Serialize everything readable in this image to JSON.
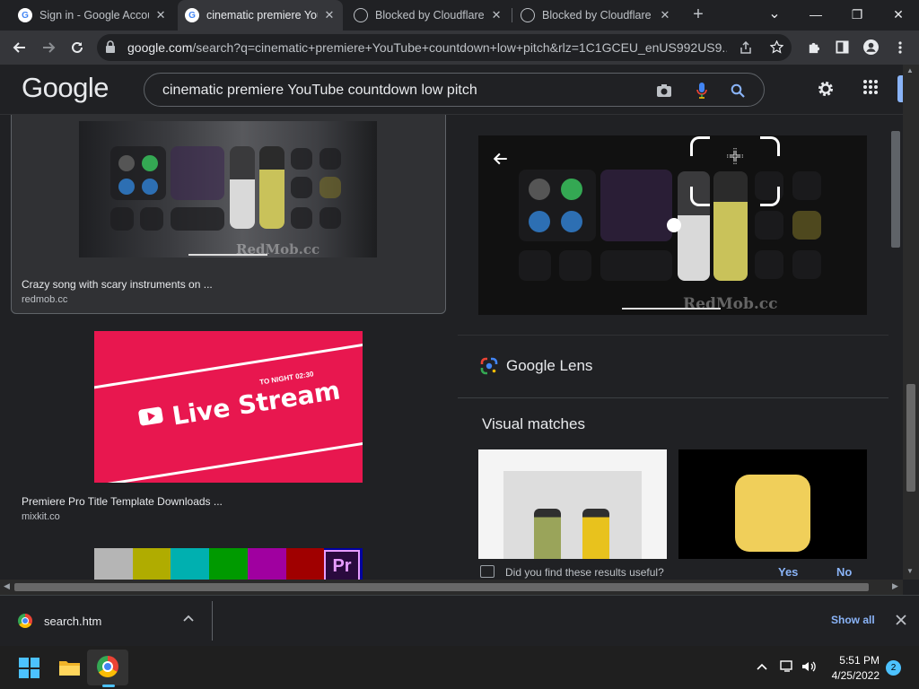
{
  "browser": {
    "tabs": [
      {
        "title": "Sign in - Google Accou",
        "favicon": "google-g-icon"
      },
      {
        "title": "cinematic premiere You",
        "favicon": "google-g-icon",
        "active": true
      },
      {
        "title": "Blocked by Cloudflare",
        "favicon": "globe-icon"
      },
      {
        "title": "Blocked by Cloudflare",
        "favicon": "globe-icon"
      }
    ],
    "close_glyph": "✕",
    "new_tab_glyph": "+",
    "tab_menu_glyph": "⌄",
    "window": {
      "minimize": "—",
      "restore": "❐",
      "close": "✕"
    },
    "url_host": "google.com",
    "url_rest": "/search?q=cinematic+premiere+YouTube+countdown+low+pitch&rlz=1C1GCEU_enUS992US9..."
  },
  "google": {
    "logo": "Google",
    "query": "cinematic premiere YouTube countdown low pitch"
  },
  "results": {
    "items": [
      {
        "caption": "Crazy song with scary instruments on ...",
        "source": "redmob.cc",
        "watermark": "RedMob.cc"
      },
      {
        "caption": "Premiere Pro Title Template Downloads ...",
        "source": "mixkit.co",
        "image_text": "Live Stream",
        "image_subtext": "TO NIGHT 02:30"
      }
    ],
    "third_logo": "Pr",
    "color_bars": [
      "#b5b5b5",
      "#b0ac00",
      "#00b0b0",
      "#009a00",
      "#a000a0",
      "#a00000",
      "#0000a0"
    ]
  },
  "lens_panel": {
    "preview_watermark": "RedMob.cc",
    "title": "Google Lens",
    "visual_matches_title": "Visual matches",
    "feedback_question": "Did you find these results useful?",
    "yes": "Yes",
    "no": "No"
  },
  "download_bar": {
    "file_name": "search.htm",
    "show_all": "Show all"
  },
  "taskbar": {
    "time": "5:51 PM",
    "date": "4/25/2022",
    "notification_count": "2"
  }
}
